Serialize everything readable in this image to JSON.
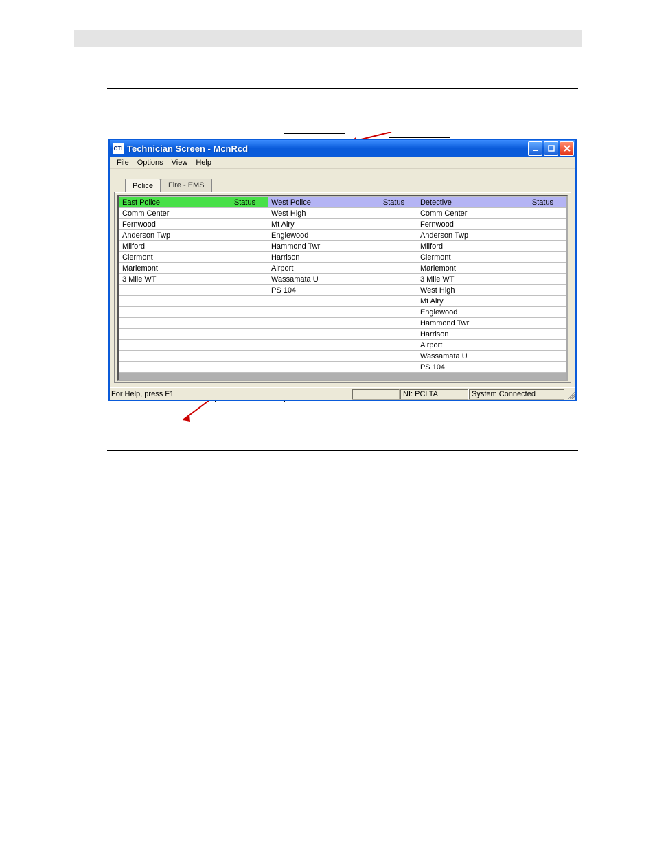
{
  "window": {
    "app_icon_text": "CTI",
    "title": "Technician Screen - McnRcd"
  },
  "menubar": {
    "items": [
      "File",
      "Options",
      "View",
      "Help"
    ]
  },
  "tabs": {
    "active": "Police",
    "inactive": "Fire - EMS"
  },
  "grid": {
    "columns": [
      {
        "name": "East Police",
        "status": "Status",
        "style": "green"
      },
      {
        "name": "West Police",
        "status": "Status",
        "style": "blue"
      },
      {
        "name": "Detective",
        "status": "Status",
        "style": "blue"
      }
    ],
    "col1_rows": [
      "Comm Center",
      "Fernwood",
      "Anderson Twp",
      "Milford",
      "Clermont",
      "Mariemont",
      "3 Mile WT",
      "",
      "",
      "",
      "",
      "",
      "",
      "",
      ""
    ],
    "col2_rows": [
      "West High",
      "Mt Airy",
      "Englewood",
      "Hammond Twr",
      "Harrison",
      "Airport",
      "Wassamata U",
      "PS 104",
      "",
      "",
      "",
      "",
      "",
      "",
      ""
    ],
    "col3_rows": [
      "Comm Center",
      "Fernwood",
      "Anderson Twp",
      "Milford",
      "Clermont",
      "Mariemont",
      "3 Mile WT",
      "West High",
      "Mt Airy",
      "Englewood",
      "Hammond Twr",
      "Harrison",
      "Airport",
      "Wassamata U",
      "PS 104"
    ]
  },
  "statusbar": {
    "help": "For Help, press F1",
    "ni": "NI: PCLTA",
    "conn": "System Connected"
  }
}
